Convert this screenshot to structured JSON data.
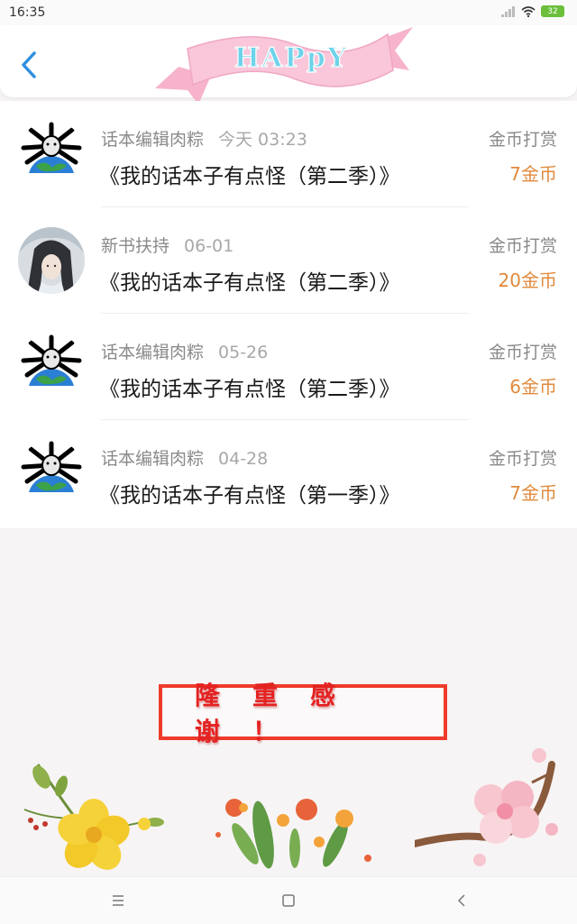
{
  "status_bar": {
    "time": "16:35",
    "battery": "32"
  },
  "header": {
    "banner_text": "HAPpY"
  },
  "tips": [
    {
      "sender": "话本编辑肉粽",
      "date": "今天 03:23",
      "book": "《我的话本子有点怪（第二季）》",
      "action": "金币打赏",
      "amount": "7金币",
      "avatar": "spider-globe"
    },
    {
      "sender": "新书扶持",
      "date": "06-01",
      "book": "《我的话本子有点怪（第二季）》",
      "action": "金币打赏",
      "amount": "20金币",
      "avatar": "anime-character"
    },
    {
      "sender": "话本编辑肉粽",
      "date": "05-26",
      "book": "《我的话本子有点怪（第二季）》",
      "action": "金币打赏",
      "amount": "6金币",
      "avatar": "spider-globe"
    },
    {
      "sender": "话本编辑肉粽",
      "date": "04-28",
      "book": "《我的话本子有点怪（第一季）》",
      "action": "金币打赏",
      "amount": "7金币",
      "avatar": "spider-globe"
    }
  ],
  "thanks": {
    "text": "隆重感谢！"
  },
  "colors": {
    "amount": "#e08a3c",
    "back_icon": "#2f8fe0",
    "thanks_border": "#ee3b2b",
    "thanks_text": "#e52222"
  }
}
